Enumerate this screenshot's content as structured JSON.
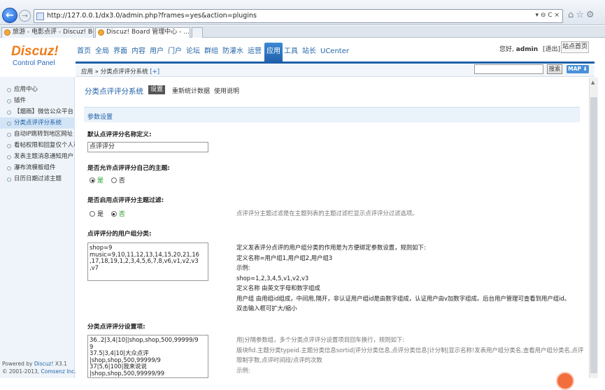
{
  "browser": {
    "url": "http://127.0.0.1/dx3.0/admin.php?frames=yes&action=plugins",
    "addr_tools": "▾ ⊖ C ×",
    "tabs": [
      {
        "label": "旅游 - 电影点评 - Discuz! Bo..."
      },
      {
        "label": "Discuz! Board 管理中心 - ..."
      }
    ]
  },
  "header": {
    "logo": "Discuz!",
    "logo_sub": "Control Panel",
    "nav": [
      "首页",
      "全局",
      "界面",
      "内容",
      "用户",
      "门户",
      "论坛",
      "群组",
      "防灌水",
      "运营",
      "应用",
      "工具",
      "站长",
      "UCenter"
    ],
    "active_nav": "应用",
    "user_greeting": "您好, ",
    "username": "admin",
    "logout": "[退出]",
    "site_home": "站点首页"
  },
  "crumb": {
    "path": "应用 » 分类点评评分系统",
    "plus": "[+]",
    "search_button": "搜索",
    "map_button": "MAP ⬇"
  },
  "sidebar": {
    "items": [
      "应用中心",
      "插件",
      "【烟雨】微信公众平台",
      "分类点评评分系统",
      "自动IP跳转到地区网址",
      "看帖权限和回复仅个人可见",
      "发表主题消息通知用户",
      "瀑布流模板组件",
      "日历日期过滤主题"
    ],
    "active_index": 3,
    "powered_by": "Powered by ",
    "powered_link": "Discuz!",
    "powered_ver": " X3.1",
    "copyright": "© 2001-2013, ",
    "copyright_link": "Comsenz Inc."
  },
  "content": {
    "title": "分类点评评分系统",
    "subnav": [
      "设置",
      "重新统计数据",
      "使用说明"
    ],
    "section_title": "参数设置",
    "q1": "默认点评评分名称定义:",
    "q1_value": "点评评分",
    "q2": "是否允许点评评分自己的主题:",
    "q2_yes": "是",
    "q2_no": "否",
    "q3": "是否启用点评评分主题过滤:",
    "q3_yes": "是",
    "q3_no": "否",
    "q3_hint": "点评评分主题过滤是在主题列表的主题过滤栏显示点评评分过滤选项。",
    "q4": "点评评分的用户组分类:",
    "q4_value": "shop=9\nmusic=9,10,11,12,13,14,15,20,21,16\n,17,18,19,1,2,3,4,5,6,7,8,v6,v1,v2,v3\n,v7",
    "q4_hint": [
      "定义发表评分点评的用户组分类的作用是为方便绑定参数设置，规则如下:",
      "定义名称=用户组1,用户组2,用户组3",
      "示例:",
      "shop=1,2,3,4,5,v1,v2,v3",
      "定义名称 由英文字母和数字组成",
      "用户组 由用组id组成，中间用,隔开，非认证用户组id是由数字组成，认证用户由v加数字组成。后台用户管理可查看到用户组id。",
      "双击输入框可扩大/缩小"
    ],
    "q5": "分类点评评分设置项:",
    "q5_value": "36..2|3,4|10||shop,shop,500,99999/9\n9\n37.5|3,4|10|大众点评\n|shop,shop,500,99999/9\n37|5,6|100|我来说说\n|shop,shop,500,99999/99",
    "q5_hint": [
      "用|分隔参数组，多个分类点评评分设置项目回车换行，规则如下:",
      "版块fid.主题分类typeid.主题分类信息sortid|评分分类信息,点评分类信息|计分制|显示名称!发表用户组分类名,查看用户组分类名,点评",
      "限制字数,点评时间段/点评的次数",
      "示例:"
    ]
  }
}
